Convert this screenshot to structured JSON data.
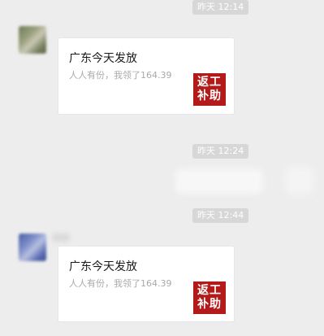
{
  "timestamps": [
    "昨天 12:14",
    "昨天 12:24",
    "昨天 12:44"
  ],
  "messages": [
    {
      "title": "广东今天发放",
      "description": "人人有份，我领了164.39",
      "thumb_line1": "返工",
      "thumb_line2": "补助"
    },
    {
      "title": "广东今天发放",
      "description": "人人有份，我领了164.39",
      "thumb_line1": "返工",
      "thumb_line2": "补助"
    }
  ],
  "colors": {
    "background": "#ededed",
    "thumb_red": "#b31b1b",
    "time_badge": "#d7d7d7"
  }
}
